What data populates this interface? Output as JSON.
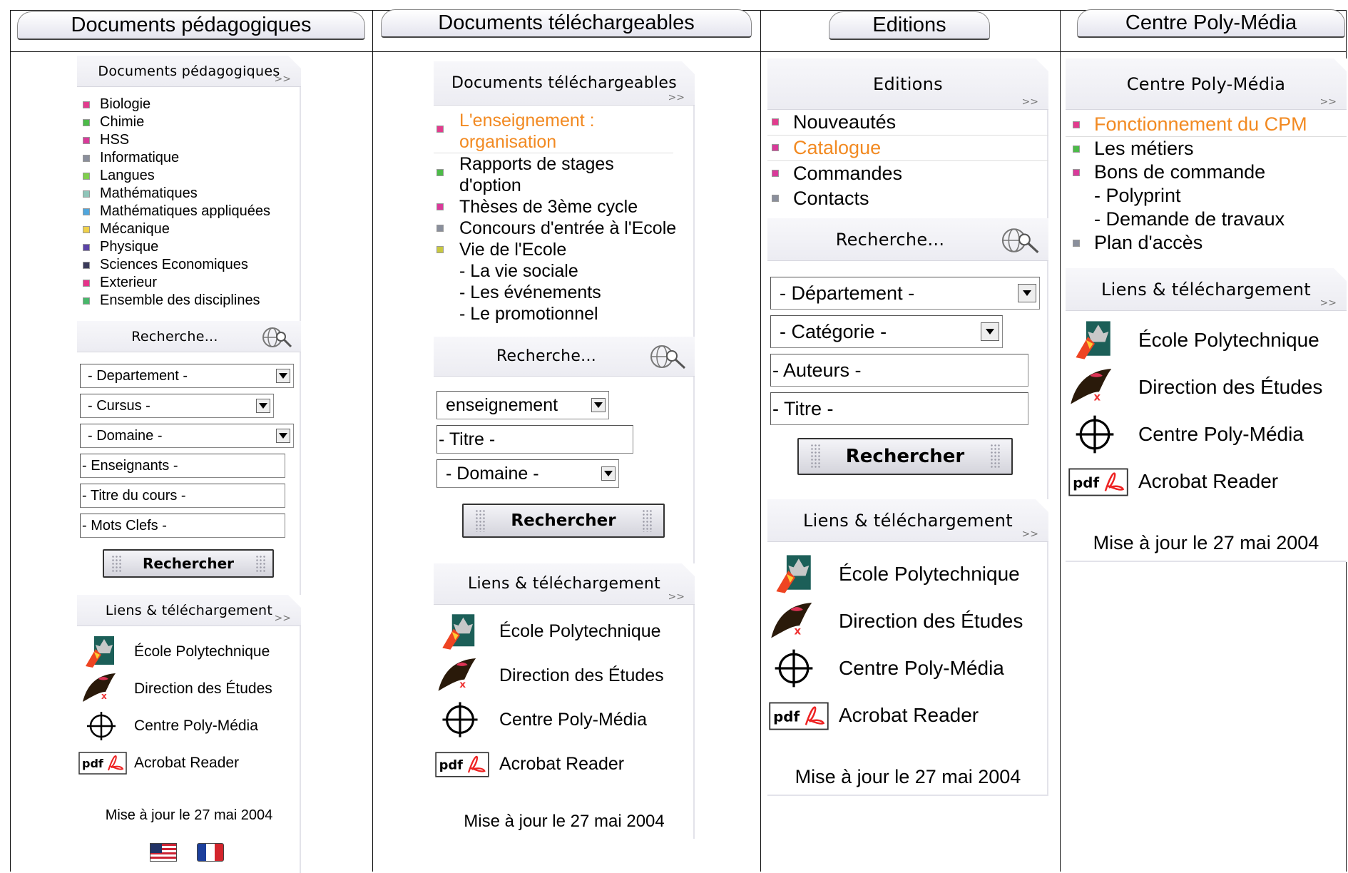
{
  "columns": [
    {
      "tab_label": "Documents pédagogiques",
      "title": "Documents pédagogiques",
      "more": ">>",
      "items": [
        {
          "label": "Biologie",
          "color": "#e23c8e"
        },
        {
          "label": "Chimie",
          "color": "#4cbb48"
        },
        {
          "label": "HSS",
          "color": "#d93a9a"
        },
        {
          "label": "Informatique",
          "color": "#8a8f9c"
        },
        {
          "label": "Langues",
          "color": "#7fcf4c"
        },
        {
          "label": "Mathématiques",
          "color": "#8fc5b9"
        },
        {
          "label": "Mathématiques appliquées",
          "color": "#4fa6dd"
        },
        {
          "label": "Mécanique",
          "color": "#f0d14a"
        },
        {
          "label": "Physique",
          "color": "#5b43a8"
        },
        {
          "label": "Sciences Economiques",
          "color": "#3a3a5a"
        },
        {
          "label": "Exterieur",
          "color": "#e7328a"
        },
        {
          "label": "Ensemble des disciplines",
          "color": "#48b76a"
        }
      ],
      "search_title": "Recherche...",
      "fields": [
        {
          "value": "- Departement -",
          "select": true
        },
        {
          "value": "- Cursus -",
          "select": true
        },
        {
          "value": "- Domaine -",
          "select": true
        },
        {
          "value": "- Enseignants -",
          "select": false
        },
        {
          "value": "- Titre du cours -",
          "select": false
        },
        {
          "value": "- Mots Clefs -",
          "select": false
        }
      ],
      "button": "Rechercher",
      "links_title": "Liens & téléchargement",
      "links": [
        "École Polytechnique",
        "Direction des Études",
        "Centre Poly-Média",
        "Acrobat Reader"
      ],
      "footer": "Mise à jour le 27 mai 2004"
    },
    {
      "tab_label": "Documents téléchargeables",
      "title": "Documents téléchargeables",
      "more": ">>",
      "items": [
        {
          "label": "L'enseignement : organisation",
          "color": "#e23c8e",
          "active": true
        },
        {
          "label": "Rapports de stages d'option",
          "color": "#4cbb48"
        },
        {
          "label": "Thèses de 3ème cycle",
          "color": "#d93a9a"
        },
        {
          "label": "Concours d'entrée à l'Ecole",
          "color": "#8a8f9c"
        },
        {
          "label": "Vie de l'Ecole",
          "color": "#c8c840"
        }
      ],
      "subitems": [
        "- La vie sociale",
        "- Les événements",
        "- Le promotionnel"
      ],
      "search_title": "Recherche...",
      "fields": [
        {
          "value": "enseignement",
          "select": true
        },
        {
          "value": "- Titre -",
          "select": false
        },
        {
          "value": "- Domaine -",
          "select": true
        }
      ],
      "button": "Rechercher",
      "links_title": "Liens & téléchargement",
      "links": [
        "École Polytechnique",
        "Direction des Études",
        "Centre Poly-Média",
        "Acrobat Reader"
      ],
      "footer": "Mise à jour le 27 mai 2004"
    },
    {
      "tab_label": "Editions",
      "title": "Editions",
      "more": ">>",
      "items": [
        {
          "label": "Nouveautés",
          "color": "#e23c8e"
        },
        {
          "label": "Catalogue",
          "color": "#d93a9a",
          "active": true
        },
        {
          "label": "Commandes",
          "color": "#d93a9a"
        },
        {
          "label": "Contacts",
          "color": "#8a8f9c"
        }
      ],
      "search_title": "Recherche...",
      "fields": [
        {
          "value": "- Département -",
          "select": true
        },
        {
          "value": "- Catégorie -",
          "select": true
        },
        {
          "value": "- Auteurs -",
          "select": false
        },
        {
          "value": "- Titre -",
          "select": false
        }
      ],
      "button": "Rechercher",
      "links_title": "Liens & téléchargement",
      "links": [
        "École Polytechnique",
        "Direction des Études",
        "Centre Poly-Média",
        "Acrobat Reader"
      ],
      "footer": "Mise à jour le 27 mai 2004"
    },
    {
      "tab_label": "Centre Poly-Média",
      "title": "Centre Poly-Média",
      "more": ">>",
      "items": [
        {
          "label": "Fonctionnement du CPM",
          "color": "#e23c8e",
          "active": true
        },
        {
          "label": "Les métiers",
          "color": "#4cbb48"
        },
        {
          "label": "Bons de commande",
          "color": "#d93a9a"
        }
      ],
      "subitems": [
        "- Polyprint",
        "- Demande de travaux"
      ],
      "last_item": {
        "label": "Plan d'accès",
        "color": "#8a8f9c"
      },
      "links_title": "Liens & téléchargement",
      "links": [
        "École Polytechnique",
        "Direction des Études",
        "Centre Poly-Média",
        "Acrobat Reader"
      ],
      "footer": "Mise à jour le 27 mai 2004"
    }
  ]
}
